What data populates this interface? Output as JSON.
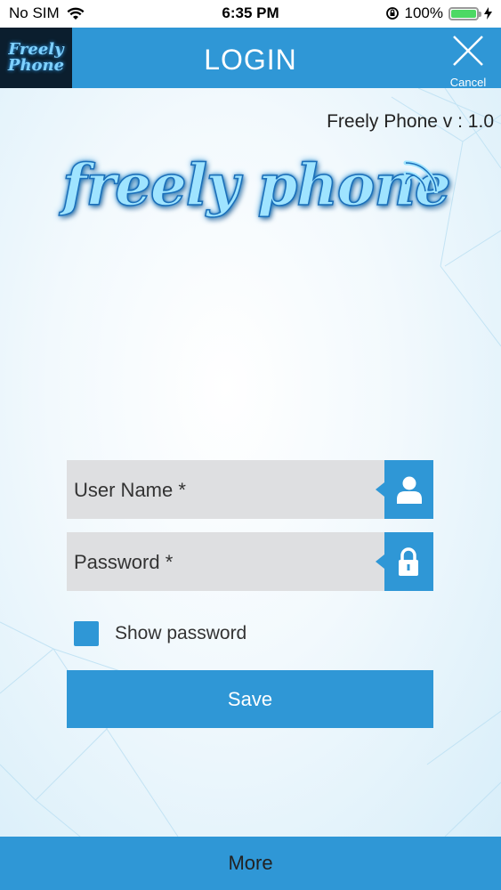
{
  "status_bar": {
    "carrier": "No SIM",
    "time": "6:35 PM",
    "battery": "100%"
  },
  "header": {
    "logo_line1": "Freely",
    "logo_line2": "Phone",
    "title": "LOGIN",
    "cancel_label": "Cancel"
  },
  "version": "Freely Phone  v : 1.0",
  "brand": "freely phone",
  "form": {
    "username_placeholder": "User Name *",
    "password_placeholder": "Password *",
    "show_password_label": "Show password",
    "save_label": "Save"
  },
  "footer": {
    "more_label": "More"
  },
  "colors": {
    "accent": "#2f97d6",
    "field_bg": "#dedfe1"
  }
}
